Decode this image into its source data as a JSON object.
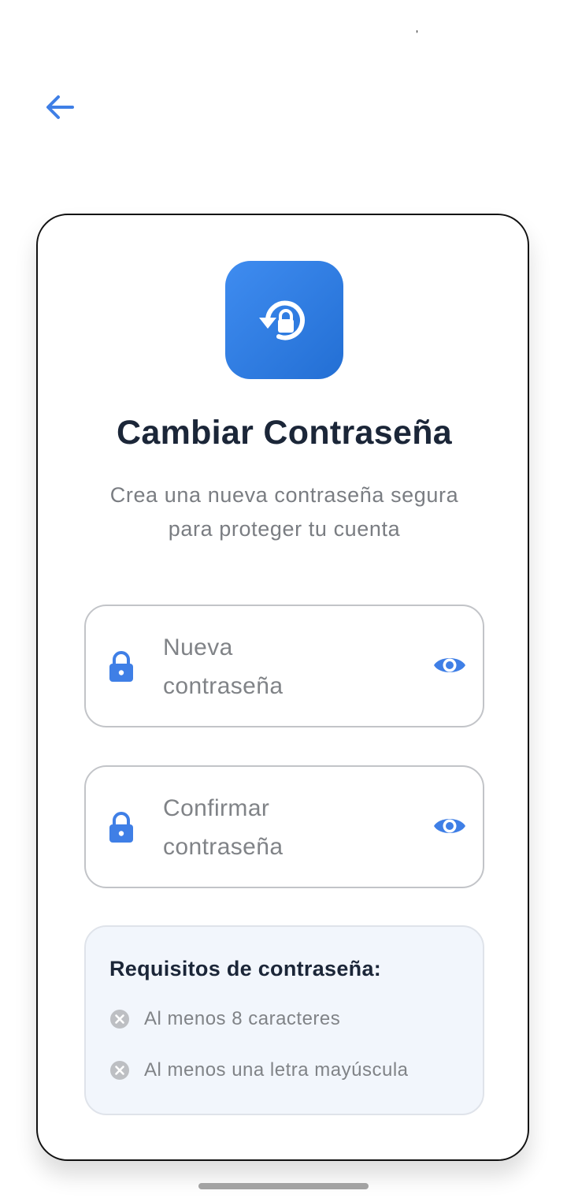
{
  "status_bar": {
    "mark": "ʼ"
  },
  "header": {
    "back_icon": "arrow-left-icon"
  },
  "card": {
    "icon": "lock-reset-icon",
    "title": "Cambiar Contraseña",
    "subtitle": "Crea una nueva contraseña segura para proteger tu cuenta"
  },
  "fields": {
    "new_password": {
      "placeholder": "Nueva contraseña",
      "leading_icon": "lock-icon",
      "trailing_icon": "eye-icon"
    },
    "confirm_password": {
      "placeholder": "Confirmar contraseña",
      "leading_icon": "lock-icon",
      "trailing_icon": "eye-icon"
    }
  },
  "requirements": {
    "title": "Requisitos de contraseña:",
    "items": [
      {
        "text": "Al menos 8 caracteres",
        "icon": "x-circle-icon"
      },
      {
        "text": "Al menos una letra mayúscula",
        "icon": "x-circle-icon"
      }
    ]
  },
  "colors": {
    "accent": "#3F7FE6",
    "title": "#1B2638",
    "muted": "#808387",
    "requirements_bg": "#F2F6FC"
  }
}
